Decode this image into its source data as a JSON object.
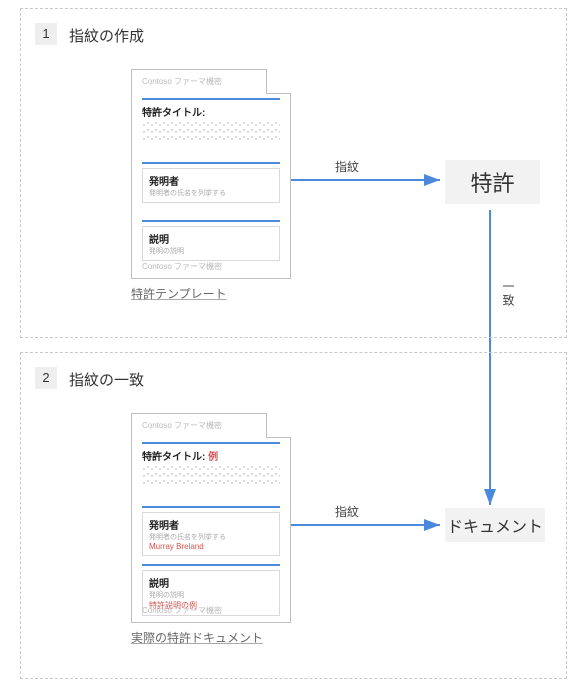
{
  "step1": {
    "number": "1",
    "title": "指紋の作成",
    "doc": {
      "header": "Contoso ファーマ機密",
      "footer": "Contoso ファーマ機密",
      "section1_label": "特許タイトル:",
      "section2_label": "発明者",
      "section2_sub": "発明者の氏名を列挙する",
      "section3_label": "説明",
      "section3_sub": "発明の説明"
    },
    "caption": "特許テンプレート",
    "arrow_label": "指紋",
    "node": "特許"
  },
  "match_arrow_label": "一致",
  "step2": {
    "number": "2",
    "title": "指紋の一致",
    "doc": {
      "header": "Contoso ファーマ機密",
      "footer": "Contoso ファーマ機密",
      "section1_label": "特許タイトル:",
      "section1_value": "例",
      "section2_label": "発明者",
      "section2_sub": "発明者の氏名を列挙する",
      "section2_value": "Murray Breland",
      "section3_label": "説明",
      "section3_sub": "発明の説明",
      "section3_value": "特許説明の例"
    },
    "caption": "実際の特許ドキュメント",
    "arrow_label": "指紋",
    "node": "ドキュメント"
  }
}
